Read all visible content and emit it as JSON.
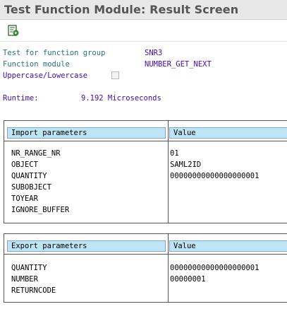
{
  "window": {
    "title": "Test Function Module: Result Screen"
  },
  "toolbar": {
    "items": [
      {
        "icon": "execute-list-icon"
      }
    ]
  },
  "header_fields": {
    "function_group_label": "Test for function group",
    "function_group_value": "SNR3",
    "function_module_label": "Function module",
    "function_module_value": "NUMBER_GET_NEXT",
    "case_label": "Uppercase/Lowercase",
    "case_checked": false,
    "runtime_label": "Runtime:",
    "runtime_value": "9.192 Microseconds"
  },
  "import_table": {
    "header_param": "Import parameters",
    "header_value": "Value",
    "rows": [
      {
        "name": "NR_RANGE_NR",
        "value": "01"
      },
      {
        "name": "OBJECT",
        "value": "SAML2ID"
      },
      {
        "name": "QUANTITY",
        "value": "00000000000000000001"
      },
      {
        "name": "SUBOBJECT",
        "value": ""
      },
      {
        "name": "TOYEAR",
        "value": ""
      },
      {
        "name": "IGNORE_BUFFER",
        "value": ""
      }
    ]
  },
  "export_table": {
    "header_param": "Export parameters",
    "header_value": "Value",
    "rows": [
      {
        "name": "QUANTITY",
        "value": "00000000000000000001"
      },
      {
        "name": "NUMBER",
        "value": "00000001"
      },
      {
        "name": "RETURNCODE",
        "value": ""
      }
    ]
  }
}
